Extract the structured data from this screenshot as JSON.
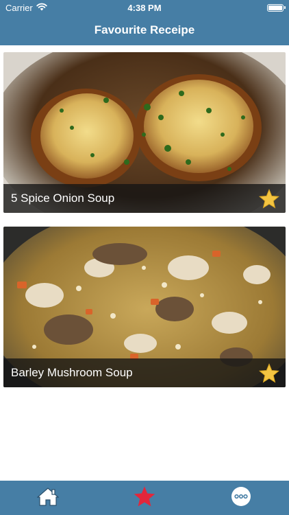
{
  "status_bar": {
    "carrier": "Carrier",
    "time": "4:38 PM",
    "icons": [
      "wifi-icon",
      "battery-icon"
    ]
  },
  "nav": {
    "title": "Favourite Receipe"
  },
  "recipes": [
    {
      "title": "5 Spice Onion Soup",
      "favourite": true,
      "icon": "star-icon"
    },
    {
      "title": "Barley Mushroom Soup",
      "favourite": true,
      "icon": "star-icon"
    }
  ],
  "tab_bar": {
    "tabs": [
      {
        "icon": "home-icon",
        "selected": false
      },
      {
        "icon": "star-icon",
        "selected": true
      },
      {
        "icon": "more-icon",
        "selected": false
      }
    ]
  },
  "colors": {
    "brand": "#467ea5",
    "favourite_star": "#f4c542",
    "active_tab_star": "#e3263b",
    "caption_background": "#141414"
  }
}
